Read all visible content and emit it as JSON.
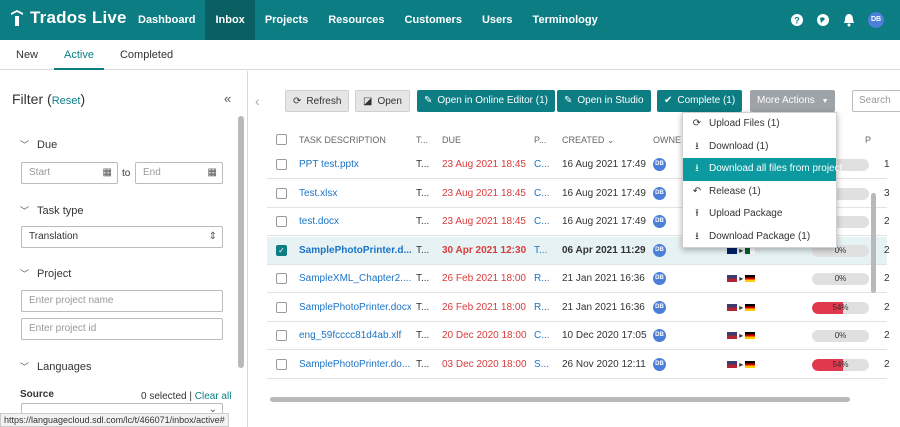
{
  "app": {
    "logo_text": "Trados Live"
  },
  "nav": [
    "Dashboard",
    "Inbox",
    "Projects",
    "Resources",
    "Customers",
    "Users",
    "Terminology"
  ],
  "nav_active": 1,
  "user_initials": "DB",
  "subtabs": [
    "New",
    "Active",
    "Completed"
  ],
  "filter": {
    "title": "Filter",
    "reset": "Reset",
    "due_label": "Due",
    "start_placeholder": "Start",
    "to": "to",
    "end_placeholder": "End",
    "task_type_label": "Task type",
    "task_type_value": "Translation",
    "project_label": "Project",
    "project_name_placeholder": "Enter project name",
    "project_id_placeholder": "Enter project id",
    "languages_label": "Languages",
    "source_label": "Source",
    "selected_text": "0 selected",
    "clear_all": "Clear all"
  },
  "status_url": "https://languagecloud.sdl.com/lc/t/466071/inbox/active#",
  "toolbar": {
    "refresh": "Refresh",
    "open": "Open",
    "open_online": "Open in Online Editor (1)",
    "open_studio": "Open in Studio",
    "complete": "Complete (1)",
    "more_actions": "More Actions",
    "search_placeholder": "Search"
  },
  "columns": {
    "task": "TASK DESCRIPTION",
    "t": "T...",
    "due": "DUE",
    "p": "P...",
    "created": "CREATED",
    "owner": "OWNE",
    "last": "P"
  },
  "rows": [
    {
      "task": "PPT test.pptx",
      "t": "T...",
      "due": "23 Aug 2021 18:45",
      "p": "C...",
      "created": "16 Aug 2021 17:49",
      "owner": "DB",
      "src": "",
      "tgt": "",
      "progress_text": "",
      "progress": 0,
      "last": "1",
      "selected": false
    },
    {
      "task": "Test.xlsx",
      "t": "T...",
      "due": "23 Aug 2021 18:45",
      "p": "C...",
      "created": "16 Aug 2021 17:49",
      "owner": "DB",
      "src": "",
      "tgt": "",
      "progress_text": "",
      "progress": 0,
      "last": "3",
      "selected": false
    },
    {
      "task": "test.docx",
      "t": "T...",
      "due": "23 Aug 2021 18:45",
      "p": "C...",
      "created": "16 Aug 2021 17:49",
      "owner": "DB",
      "src": "",
      "tgt": "",
      "progress_text": "",
      "progress": 0,
      "last": "2",
      "selected": false
    },
    {
      "task": "SamplePhotoPrinter.d...",
      "t": "T...",
      "due": "30 Apr 2021 12:30",
      "p": "T...",
      "created": "06 Apr 2021 11:29",
      "owner": "DB",
      "src": "gb",
      "tgt": "dz",
      "progress_text": "0%",
      "progress": 0,
      "last": "2",
      "selected": true
    },
    {
      "task": "SampleXML_Chapter2....",
      "t": "T...",
      "due": "26 Feb 2021 18:00",
      "p": "R...",
      "created": "21 Jan 2021 16:36",
      "owner": "DB",
      "src": "us",
      "tgt": "de",
      "progress_text": "0%",
      "progress": 0,
      "last": "2",
      "selected": false
    },
    {
      "task": "SamplePhotoPrinter.docx",
      "t": "T...",
      "due": "26 Feb 2021 18:00",
      "p": "R...",
      "created": "21 Jan 2021 16:36",
      "owner": "DB",
      "src": "us",
      "tgt": "de",
      "progress_text": "54%",
      "progress": 54,
      "last": "2",
      "selected": false
    },
    {
      "task": "eng_59fcccc81d4ab.xlf",
      "t": "T...",
      "due": "20 Dec 2020 18:00",
      "p": "C...",
      "created": "10 Dec 2020 17:05",
      "owner": "DB",
      "src": "us",
      "tgt": "de",
      "progress_text": "0%",
      "progress": 0,
      "last": "2",
      "selected": false
    },
    {
      "task": "SamplePhotoPrinter.do...",
      "t": "T...",
      "due": "03 Dec 2020 18:00",
      "p": "S...",
      "created": "26 Nov 2020 12:11",
      "owner": "DB",
      "src": "us",
      "tgt": "de",
      "progress_text": "54%",
      "progress": 54,
      "last": "2",
      "selected": false
    }
  ],
  "more_menu": [
    {
      "label": "Upload Files (1)",
      "icon": "sync-icon",
      "highlight": false
    },
    {
      "label": "Download (1)",
      "icon": "download-icon",
      "highlight": false
    },
    {
      "label": "Download all files from project",
      "icon": "download-icon",
      "highlight": true
    },
    {
      "label": "Release (1)",
      "icon": "undo-icon",
      "highlight": false
    },
    {
      "label": "Upload Package",
      "icon": "upload-icon",
      "highlight": false
    },
    {
      "label": "Download Package (1)",
      "icon": "download-icon",
      "highlight": false
    }
  ],
  "colors": {
    "teal": "#0c7d83",
    "teal_dark": "#0a5f63",
    "menu_highlight": "#0c9aa0",
    "due_red": "#d83b3b",
    "link": "#1b74c6",
    "progress_red": "#e0384c"
  }
}
